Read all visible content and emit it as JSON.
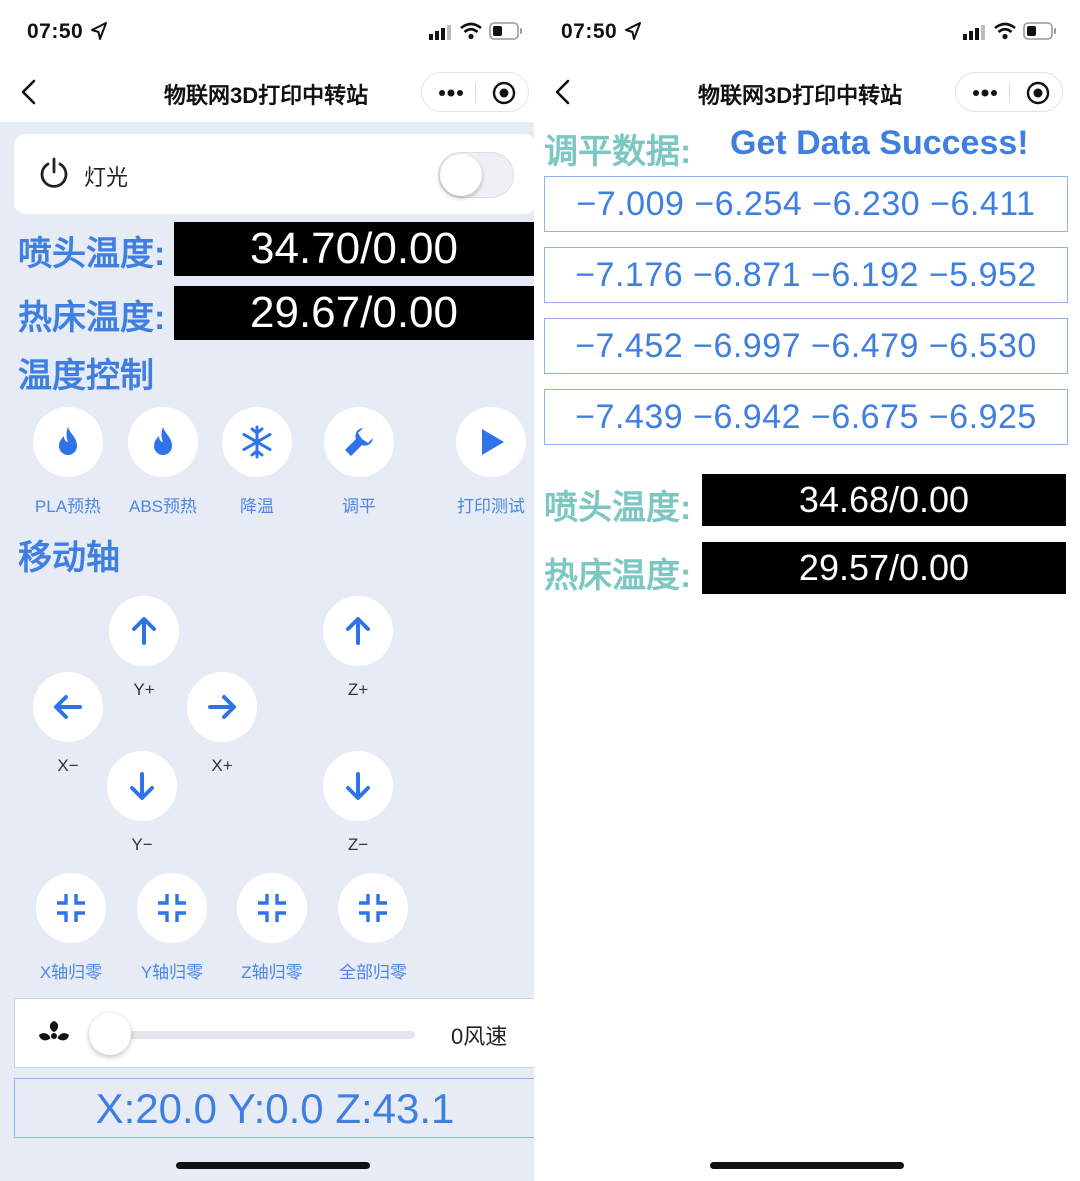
{
  "status_bar": {
    "time": "07:50"
  },
  "nav": {
    "title": "物联网3D打印中转站"
  },
  "left": {
    "light": {
      "label": "灯光",
      "on": false
    },
    "nozzle_temp": {
      "label": "喷头温度:",
      "value": "34.70/0.00"
    },
    "bed_temp": {
      "label": "热床温度:",
      "value": "29.67/0.00"
    },
    "temp_control": {
      "title": "温度控制",
      "buttons": [
        {
          "label": "PLA预热",
          "icon": "flame-icon"
        },
        {
          "label": "ABS预热",
          "icon": "flame-icon"
        },
        {
          "label": "降温",
          "icon": "snowflake-icon"
        },
        {
          "label": "调平",
          "icon": "wrench-icon"
        },
        {
          "label": "打印测试",
          "icon": "play-icon"
        }
      ]
    },
    "move_axis": {
      "title": "移动轴",
      "y_plus": "Y+",
      "y_minus": "Y−",
      "x_plus": "X+",
      "x_minus": "X−",
      "z_plus": "Z+",
      "z_minus": "Z−"
    },
    "homing": [
      {
        "label": "X轴归零"
      },
      {
        "label": "Y轴归零"
      },
      {
        "label": "Z轴归零"
      },
      {
        "label": "全部归零"
      }
    ],
    "fan": {
      "value_label": "0风速",
      "level": 0
    },
    "position": {
      "text": "X:20.0 Y:0.0 Z:43.1"
    }
  },
  "right": {
    "leveling_title": "调平数据:",
    "leveling_message": "Get Data Success!",
    "leveling_rows": [
      "−7.009 −6.254 −6.230 −6.411",
      "−7.176 −6.871 −6.192 −5.952",
      "−7.452 −6.997 −6.479 −6.530",
      "−7.439 −6.942 −6.675 −6.925"
    ],
    "nozzle_temp": {
      "label": "喷头温度:",
      "value": "34.68/0.00"
    },
    "bed_temp": {
      "label": "热床温度:",
      "value": "29.57/0.00"
    }
  },
  "colors": {
    "accent_blue": "#3f7fe0",
    "teal_label": "#7cc7c2",
    "panel_bg": "#e6ebf6",
    "value_bg": "#000000"
  }
}
